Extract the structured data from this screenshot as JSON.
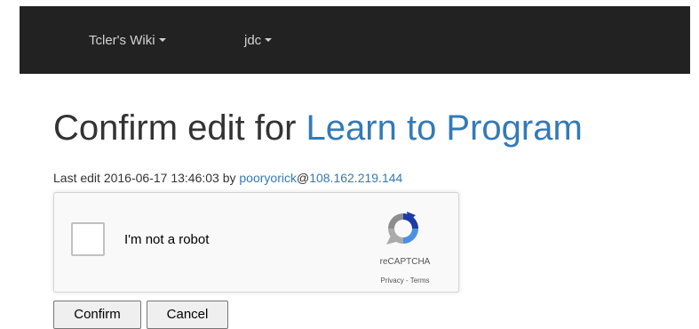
{
  "navbar": {
    "wiki_label": "Tcler's Wiki",
    "user_label": "jdc",
    "background": "#222222"
  },
  "heading": {
    "prefix": "Confirm edit for ",
    "page_link": "Learn to Program"
  },
  "meta": {
    "prefix": "Last edit 2016-06-17 13:46:03 by ",
    "user_link": "pooryorick",
    "at": "@",
    "ip_link": "108.162.219.144"
  },
  "captcha": {
    "label": "I'm not a robot",
    "brand": "reCAPTCHA",
    "privacy": "Privacy",
    "separator": " - ",
    "terms": "Terms"
  },
  "buttons": {
    "confirm": "Confirm",
    "cancel": "Cancel"
  },
  "colors": {
    "link": "#337ab7",
    "text": "#333333"
  }
}
